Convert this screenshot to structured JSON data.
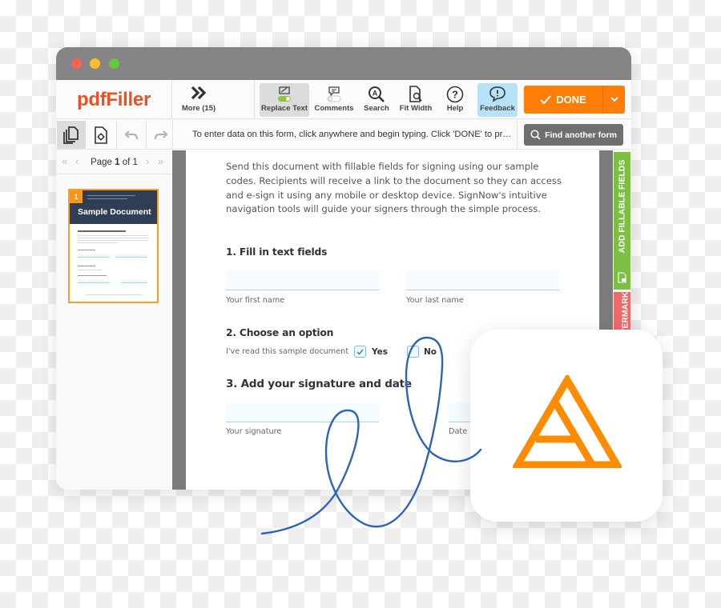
{
  "app": {
    "logo": "pdfFiller"
  },
  "toolbar": {
    "more_label": "More (15)",
    "replace_text_label": "Replace Text",
    "comments_label": "Comments",
    "search_label": "Search",
    "fit_width_label": "Fit Width",
    "help_label": "Help",
    "feedback_label": "Feedback",
    "done_label": "DONE",
    "replace_text_toggle": "on",
    "comments_toggle": "off"
  },
  "subtoolbar": {
    "hint": "To enter data on this form, click anywhere and begin typing. Click 'DONE' to pr…",
    "find_form_label": "Find another form"
  },
  "pages_panel": {
    "page_prefix": "Page ",
    "current_page": "1",
    "page_of": " of ",
    "total_pages": "1",
    "thumbnail": {
      "number": "1",
      "title": "Sample Document"
    }
  },
  "side_tabs": {
    "add_fields": "ADD FILLABLE FIELDS",
    "watermark": "WATERMARK"
  },
  "document": {
    "intro": "Send this document with fillable fields for signing using our sample codes. Recipients will receive a link to the document so they can access and e-sign it using any mobile or desktop device. SignNow's intuitive navigation tools will guide your signers through the simple process.",
    "section1_title": "1. Fill in text fields",
    "first_name_label": "Your first name",
    "last_name_label": "Your last name",
    "section2_title": "2. Choose an option",
    "option_prompt": "I've read this sample document",
    "option_yes": "Yes",
    "option_no": "No",
    "yes_checked": true,
    "no_checked": false,
    "section3_title": "3. Add your signature and date",
    "signature_label": "Your signature",
    "date_label": "Date"
  },
  "colors": {
    "brand_orange": "#fd7d08",
    "logo_red": "#ea5224",
    "add_fields_green": "#7dbf45",
    "watermark_red": "#ee6a6a",
    "signature_blue": "#2f63b8",
    "app_icon_orange": "#ff8c00"
  }
}
